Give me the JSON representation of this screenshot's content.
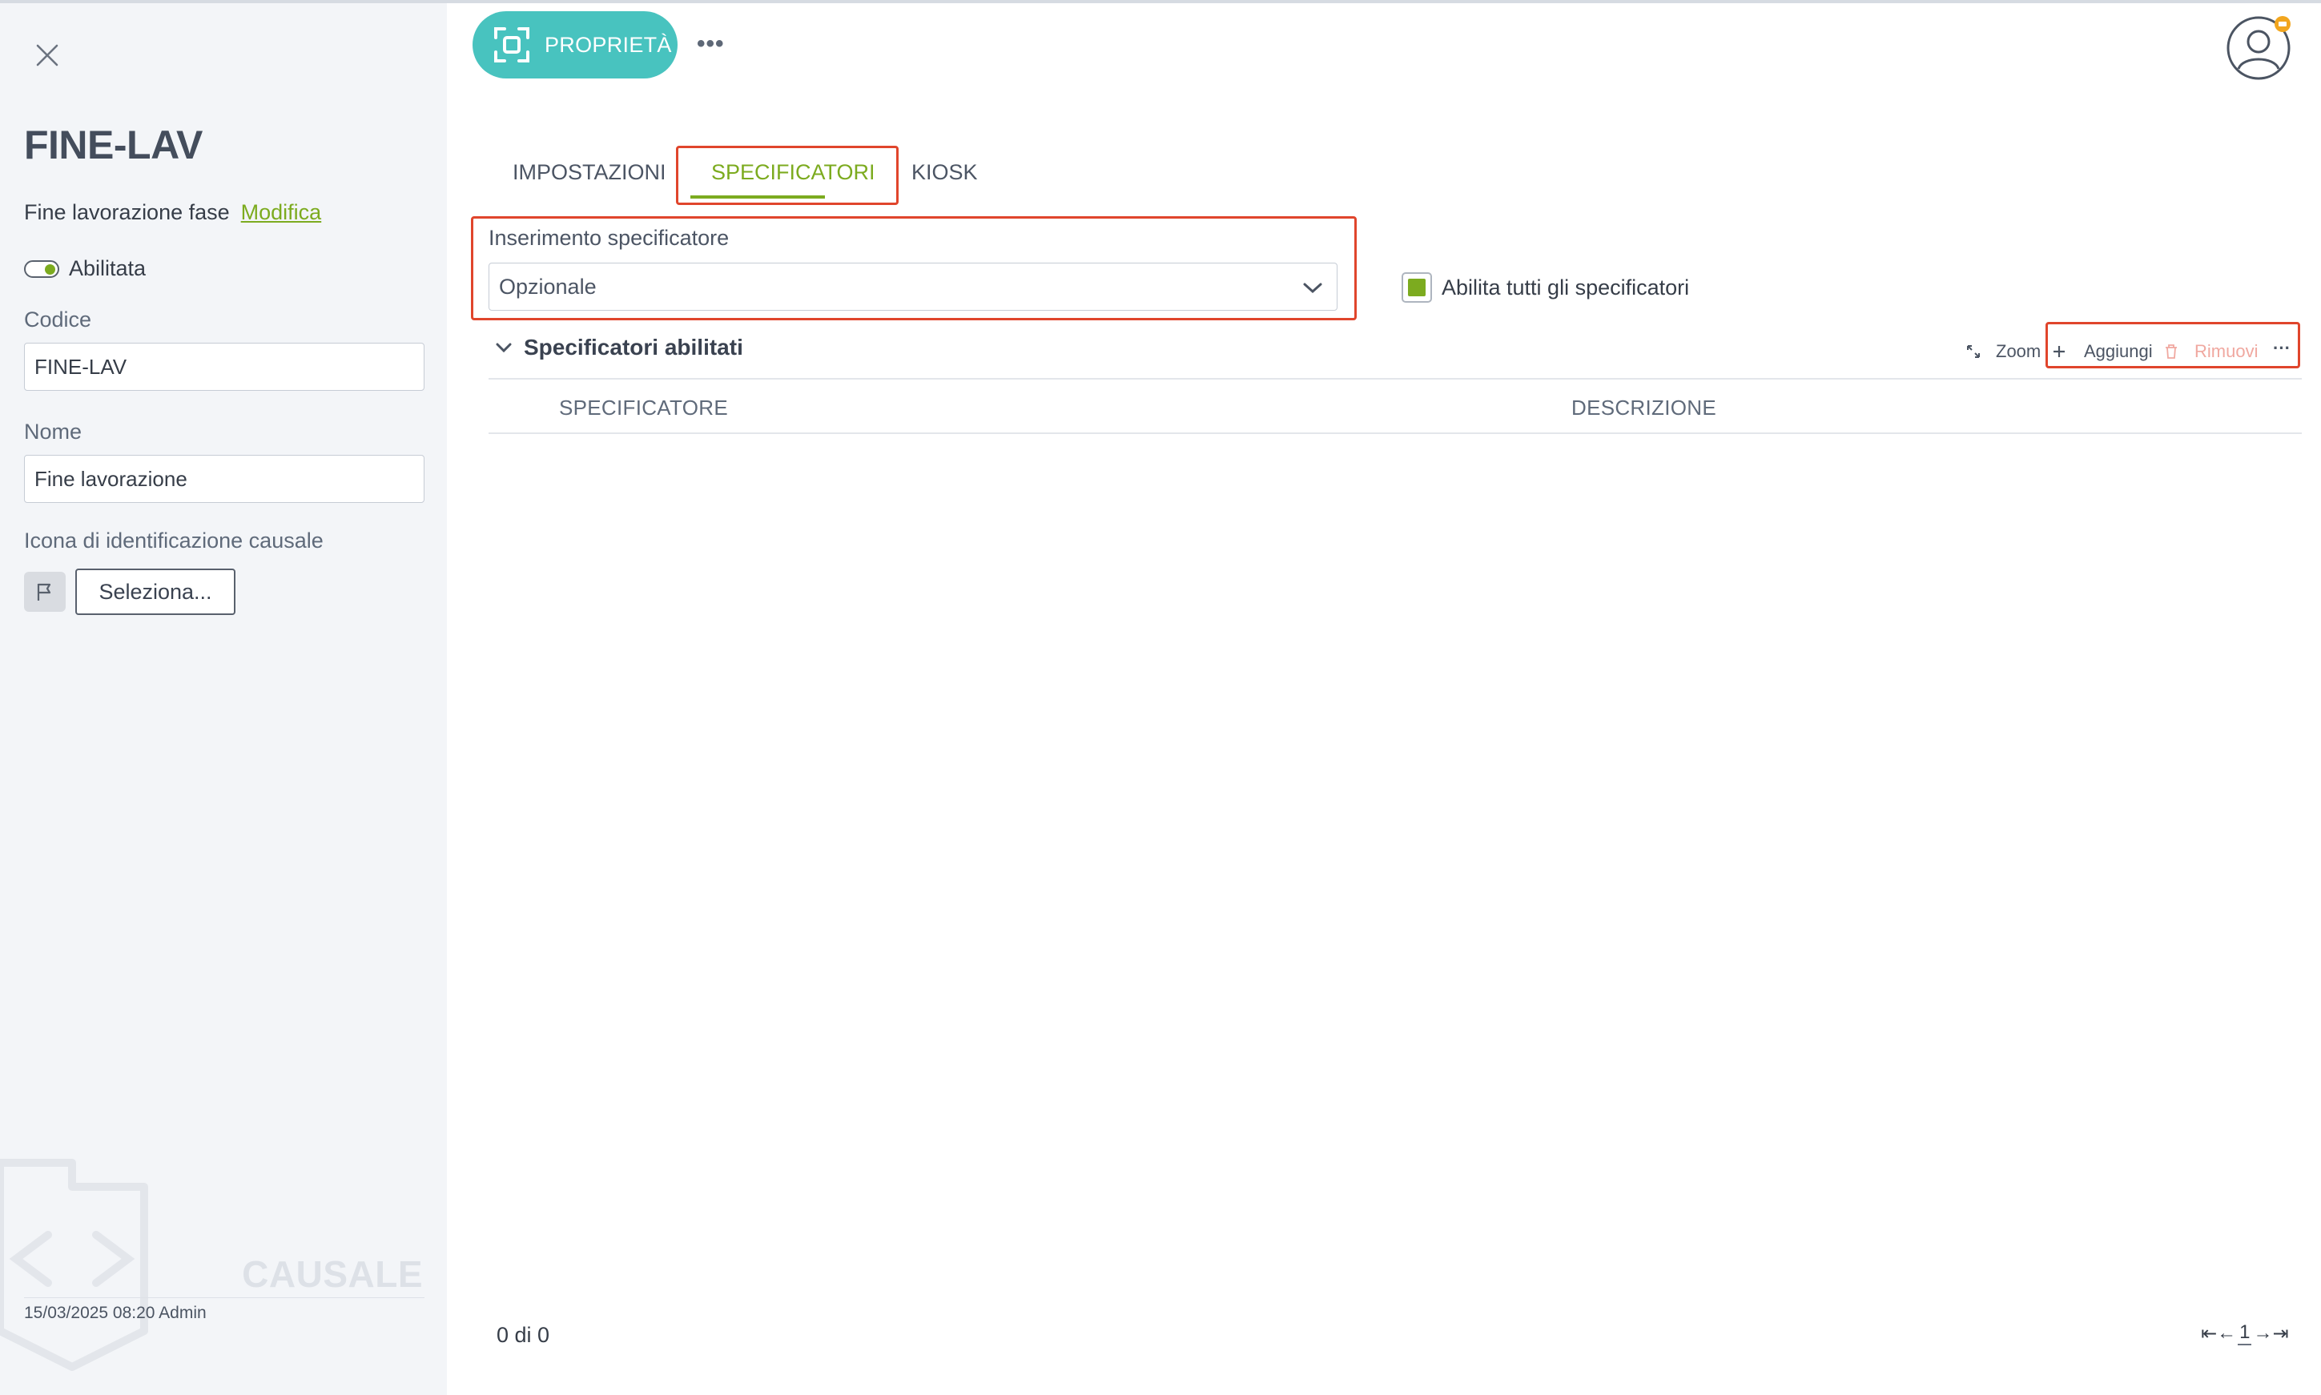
{
  "left_panel": {
    "code": "FINE-LAV",
    "description": "Fine lavorazione fase",
    "edit_link": "Modifica",
    "toggle_label": "Abilitata",
    "toggle_on": true,
    "codice_label": "Codice",
    "codice_value": "FINE-LAV",
    "nome_label": "Nome",
    "nome_value": "Fine lavorazione",
    "icon_label": "Icona di identificazione causale",
    "icon_name": "flag-icon",
    "select_button": "Seleziona...",
    "entity_type": "CAUSALE",
    "footer": "15/03/2025 08:20 Admin"
  },
  "header": {
    "primary_button": "PROPRIETÀ",
    "more_icon": "ellipsis-icon",
    "avatar_icon": "user-avatar-icon",
    "accent_color": "#48c3bf"
  },
  "tabs": [
    {
      "label": "IMPOSTAZIONI",
      "active": false
    },
    {
      "label": "SPECIFICATORI",
      "active": true
    },
    {
      "label": "KIOSK",
      "active": false
    }
  ],
  "specificatori": {
    "insert_label": "Inserimento specificatore",
    "insert_value": "Opzionale",
    "enable_all_label": "Abilita tutti gli specificatori",
    "enable_all_checked": true,
    "section_title": "Specificatori abilitati",
    "toolbar": {
      "zoom": "Zoom",
      "add": "Aggiungi",
      "remove": "Rimuovi",
      "more": "···"
    },
    "columns": [
      "SPECIFICATORE",
      "DESCRIZIONE"
    ],
    "rows": [],
    "count_text": "0 di 0",
    "pager": {
      "first": "⇤",
      "prev": "←",
      "page": "1",
      "next": "→",
      "last": "⇥"
    }
  },
  "colors": {
    "accent_green": "#7cab1f",
    "highlight_red": "#e0452c",
    "teal": "#48c3bf"
  }
}
